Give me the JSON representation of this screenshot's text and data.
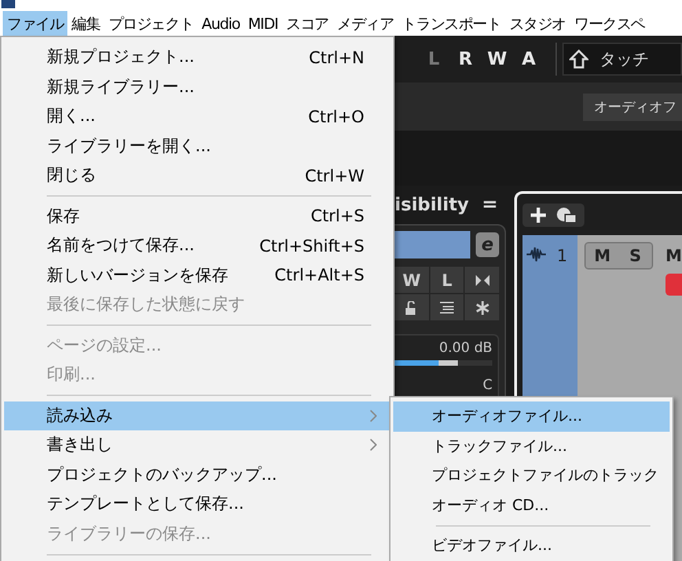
{
  "menubar": [
    {
      "label": "ファイル",
      "selected": true
    },
    {
      "label": "編集",
      "selected": false
    },
    {
      "label": "プロジェクト",
      "selected": false
    },
    {
      "label": "Audio",
      "selected": false
    },
    {
      "label": "MIDI",
      "selected": false
    },
    {
      "label": "スコア",
      "selected": false
    },
    {
      "label": "メディア",
      "selected": false
    },
    {
      "label": "トランスポート",
      "selected": false
    },
    {
      "label": "スタジオ",
      "selected": false
    },
    {
      "label": "ワークスペ",
      "selected": false
    }
  ],
  "toolbar": {
    "automation_buttons": [
      {
        "label": "L",
        "active": false
      },
      {
        "label": "R",
        "active": true
      },
      {
        "label": "W",
        "active": true
      },
      {
        "label": "A",
        "active": true
      }
    ],
    "mode": "タッチ"
  },
  "secondary_toolbar": {
    "button": "オーディオフ"
  },
  "inspector": {
    "title": "isibility",
    "menu_glyph": "=",
    "edit_glyph": "e",
    "grid_labels": [
      "W",
      "L"
    ],
    "volume": {
      "reading": "0.00 dB",
      "level": 0.45
    },
    "pan": "C"
  },
  "tracks": [
    {
      "number": "1",
      "selected": true,
      "buttons": [
        "M",
        "S"
      ],
      "extra_button": "M"
    }
  ],
  "file_menu": [
    {
      "kind": "item",
      "label": "新規プロジェクト...",
      "shortcut": "Ctrl+N",
      "disabled": false,
      "selected": false,
      "submenu": false
    },
    {
      "kind": "item",
      "label": "新規ライブラリー...",
      "disabled": false,
      "selected": false,
      "submenu": false
    },
    {
      "kind": "item",
      "label": "開く...",
      "shortcut": "Ctrl+O",
      "disabled": false,
      "selected": false,
      "submenu": false
    },
    {
      "kind": "item",
      "label": "ライブラリーを開く...",
      "disabled": false,
      "selected": false,
      "submenu": false
    },
    {
      "kind": "item",
      "label": "閉じる",
      "shortcut": "Ctrl+W",
      "disabled": false,
      "selected": false,
      "submenu": false
    },
    {
      "kind": "separator"
    },
    {
      "kind": "item",
      "label": "保存",
      "shortcut": "Ctrl+S",
      "disabled": false,
      "selected": false,
      "submenu": false
    },
    {
      "kind": "item",
      "label": "名前をつけて保存...",
      "shortcut": "Ctrl+Shift+S",
      "disabled": false,
      "selected": false,
      "submenu": false
    },
    {
      "kind": "item",
      "label": "新しいバージョンを保存",
      "shortcut": "Ctrl+Alt+S",
      "disabled": false,
      "selected": false,
      "submenu": false
    },
    {
      "kind": "item",
      "label": "最後に保存した状態に戻す",
      "disabled": true,
      "selected": false,
      "submenu": false
    },
    {
      "kind": "separator"
    },
    {
      "kind": "item",
      "label": "ページの設定...",
      "disabled": true,
      "selected": false,
      "submenu": false
    },
    {
      "kind": "item",
      "label": "印刷...",
      "disabled": true,
      "selected": false,
      "submenu": false
    },
    {
      "kind": "separator"
    },
    {
      "kind": "item",
      "label": "読み込み",
      "disabled": false,
      "selected": true,
      "submenu": true
    },
    {
      "kind": "item",
      "label": "書き出し",
      "disabled": false,
      "selected": false,
      "submenu": true
    },
    {
      "kind": "item",
      "label": "プロジェクトのバックアップ...",
      "disabled": false,
      "selected": false,
      "submenu": false
    },
    {
      "kind": "item",
      "label": "テンプレートとして保存...",
      "disabled": false,
      "selected": false,
      "submenu": false
    },
    {
      "kind": "item",
      "label": "ライブラリーの保存...",
      "disabled": true,
      "selected": false,
      "submenu": false
    },
    {
      "kind": "separator"
    }
  ],
  "import_submenu": [
    {
      "kind": "item",
      "label": "オーディオファイル...",
      "disabled": false,
      "selected": true
    },
    {
      "kind": "item",
      "label": "トラックファイル...",
      "disabled": false,
      "selected": false
    },
    {
      "kind": "item",
      "label": "プロジェクトファイルのトラック",
      "disabled": false,
      "selected": false
    },
    {
      "kind": "item",
      "label": "オーディオ CD...",
      "disabled": false,
      "selected": false
    },
    {
      "kind": "separator"
    },
    {
      "kind": "item",
      "label": "ビデオファイル...",
      "disabled": false,
      "selected": false
    }
  ]
}
